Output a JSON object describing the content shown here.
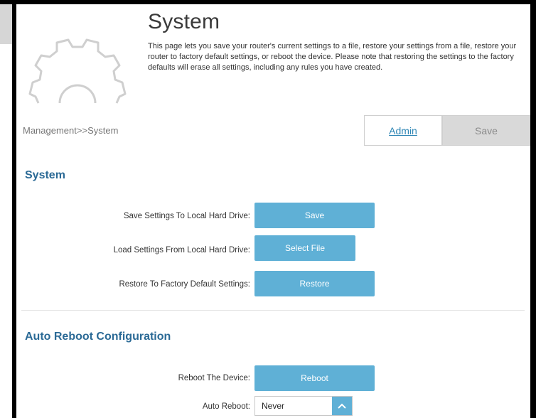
{
  "page": {
    "title": "System",
    "description": "This page lets you save your router's current settings to a file, restore your settings from a file, restore your router to factory default settings, or reboot the device. Please note that restoring the settings to the factory defaults will erase all settings, including any rules you have created.",
    "breadcrumb": "Management>>System"
  },
  "tabs": {
    "admin_label": "Admin",
    "save_label": "Save"
  },
  "system_section": {
    "title": "System",
    "rows": [
      {
        "label": "Save Settings To Local Hard Drive:",
        "button": "Save"
      },
      {
        "label": "Load Settings From Local Hard Drive:",
        "button": "Select File"
      },
      {
        "label": "Restore To Factory Default Settings:",
        "button": "Restore"
      }
    ]
  },
  "reboot_section": {
    "title": "Auto Reboot Configuration",
    "reboot_label": "Reboot The Device:",
    "reboot_button": "Reboot",
    "auto_reboot_label": "Auto Reboot:",
    "auto_reboot_value": "Never"
  },
  "icons": {
    "header_icon": "gear-icon",
    "select_arrow": "chevron-up-icon"
  },
  "colors": {
    "accent": "#5fb0d6",
    "section_title": "#2b6a96",
    "link": "#2e86b5"
  }
}
